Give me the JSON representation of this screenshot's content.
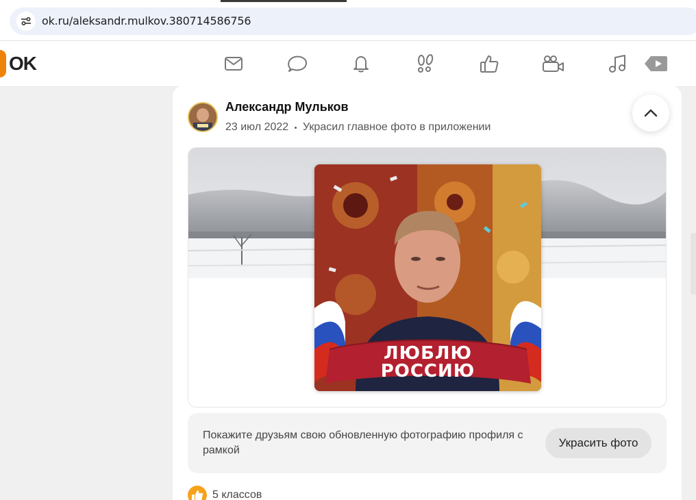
{
  "browser": {
    "url": "ok.ru/aleksandr.mulkov.380714586756"
  },
  "header": {
    "logo_text": "OK",
    "logo_color": "#ee8208",
    "nav": [
      {
        "name": "messages",
        "icon": "envelope-icon"
      },
      {
        "name": "discussions",
        "icon": "chat-bubble-icon"
      },
      {
        "name": "notifications",
        "icon": "bell-icon"
      },
      {
        "name": "guests",
        "icon": "footprints-icon"
      },
      {
        "name": "events",
        "icon": "thumbs-up-icon"
      },
      {
        "name": "video",
        "icon": "video-camera-icon"
      },
      {
        "name": "music",
        "icon": "music-note-icon"
      },
      {
        "name": "video-tv",
        "icon": "play-tag-icon"
      }
    ]
  },
  "post": {
    "author": "Александр Мульков",
    "date": "23 июл 2022",
    "separator": "•",
    "action": "Украсил главное фото в приложении",
    "frame_text_line1": "ЛЮБЛЮ",
    "frame_text_line2": "РОССИЮ",
    "promo_text": "Покажите друзьям свою обновленную фотографию профиля с рамкой",
    "promo_button": "Украсить фото",
    "likes": "5 классов"
  },
  "colors": {
    "accent": "#ee8208",
    "like_badge": "#f6a21b",
    "banner_red": "#b3202f"
  }
}
